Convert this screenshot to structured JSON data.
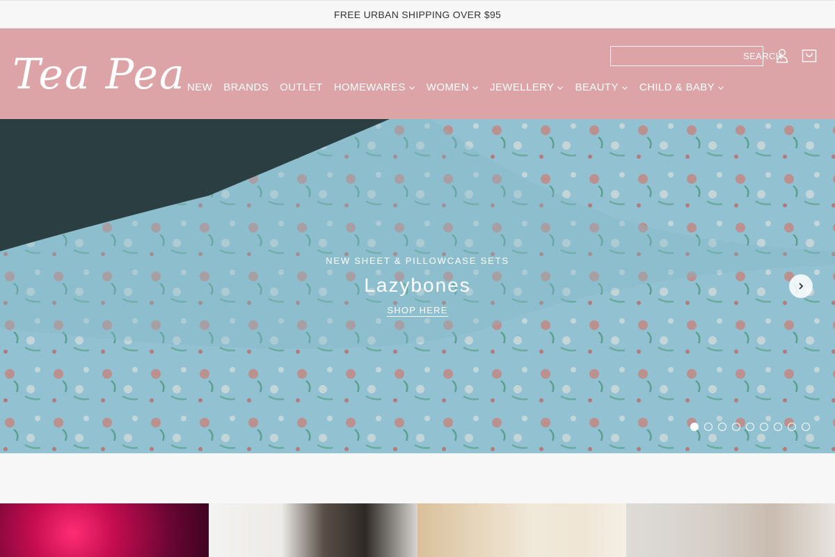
{
  "announcement": {
    "text": "FREE URBAN SHIPPING OVER $95"
  },
  "header": {
    "logo_text": "Tea Pea",
    "search": {
      "label": "SEARCH",
      "value": "",
      "placeholder": ""
    },
    "nav": [
      {
        "label": "NEW",
        "has_dropdown": false
      },
      {
        "label": "BRANDS",
        "has_dropdown": false
      },
      {
        "label": "OUTLET",
        "has_dropdown": false
      },
      {
        "label": "HOMEWARES",
        "has_dropdown": true
      },
      {
        "label": "WOMEN",
        "has_dropdown": true
      },
      {
        "label": "JEWELLERY",
        "has_dropdown": true
      },
      {
        "label": "BEAUTY",
        "has_dropdown": true
      },
      {
        "label": "CHILD & BABY",
        "has_dropdown": true
      }
    ],
    "icons": {
      "search": "search-icon",
      "account": "account-icon",
      "cart": "cart-icon"
    }
  },
  "hero": {
    "eyebrow": "NEW SHEET & PILLOWCASE SETS",
    "title": "Lazybones",
    "cta": "SHOP HERE",
    "slide_count": 9,
    "active_slide": 1
  },
  "colors": {
    "header_bg": "#dda4a7",
    "page_bg": "#f7f7f7",
    "text": "#333333"
  }
}
